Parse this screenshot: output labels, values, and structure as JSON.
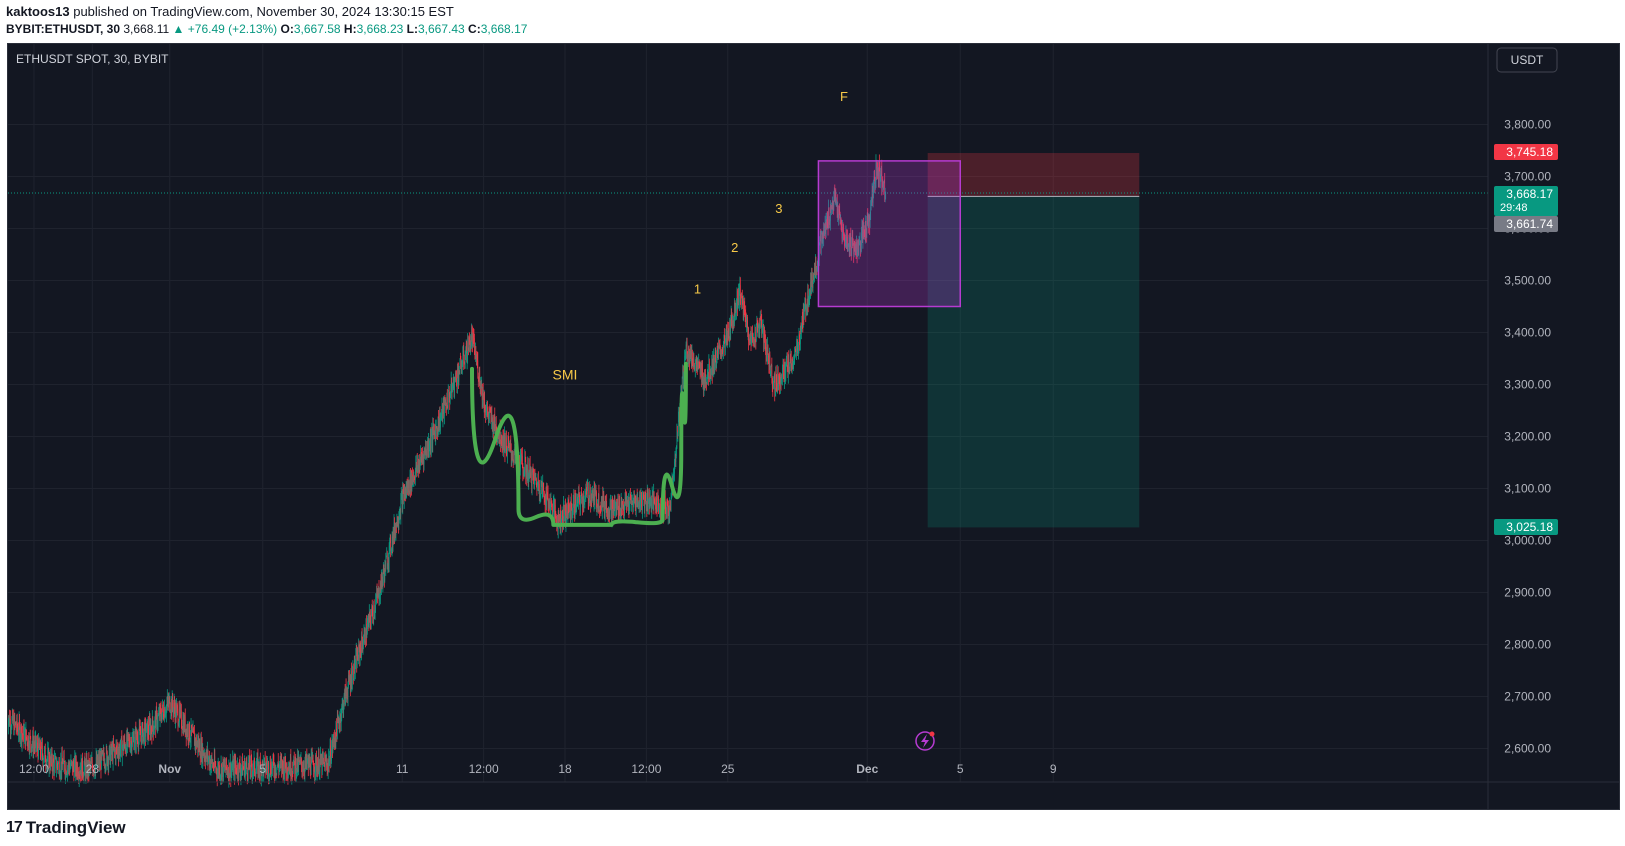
{
  "header": {
    "user": "kaktoos13",
    "published": "published on TradingView.com, November 30, 2024 13:30:15 EST",
    "symbol": "BYBIT:ETHUSDT, 30",
    "last": "3,668.11",
    "change": "▲ +76.49 (+2.13%)",
    "o_label": "O:",
    "o_value": "3,667.58",
    "h_label": "H:",
    "h_value": "3,668.23",
    "l_label": "L:",
    "l_value": "3,667.43",
    "c_label": "C:",
    "c_value": "3,668.17"
  },
  "pane": {
    "legend": "ETHUSDT SPOT, 30, BYBIT",
    "currency": "USDT"
  },
  "price_labels": {
    "stop": "3,745.18",
    "current": "3,668.17",
    "countdown": "29:48",
    "entry": "3,661.74",
    "target": "3,025.18"
  },
  "annotations": {
    "smi": "SMI",
    "w1": "1",
    "w2": "2",
    "w3": "3",
    "f": "F"
  },
  "footer": {
    "brand": "TradingView",
    "logo": "17"
  },
  "colors": {
    "background": "#131722",
    "grid": "#1f232e",
    "up": "#089981",
    "down": "#f23645",
    "curve": "#4caf50",
    "box": "#b63bd1",
    "annotation": "#f7c948"
  },
  "chart_data": {
    "type": "candlestick",
    "title": "ETHUSDT SPOT, 30, BYBIT",
    "ylim": [
      2580,
      3880
    ],
    "y_ticks": [
      2600,
      2700,
      2800,
      2900,
      3000,
      3100,
      3200,
      3300,
      3400,
      3500,
      3600,
      3700,
      3800
    ],
    "y_tick_labels": [
      "2,600.00",
      "2,700.00",
      "2,800.00",
      "2,900.00",
      "3,000.00",
      "3,100.00",
      "3,200.00",
      "3,300.00",
      "3,400.00",
      "3,500.00",
      "3,600.00",
      "3,700.00",
      "3,800.00"
    ],
    "x_range": [
      "2024-10-25",
      "2024-12-12"
    ],
    "x_ticks": [
      {
        "t": 1.16,
        "label": "12:00"
      },
      {
        "t": 3.67,
        "label": "28"
      },
      {
        "t": 7.0,
        "label": "Nov"
      },
      {
        "t": 11.0,
        "label": "5"
      },
      {
        "t": 17.0,
        "label": "11"
      },
      {
        "t": 20.5,
        "label": "12:00"
      },
      {
        "t": 24.0,
        "label": "18"
      },
      {
        "t": 27.5,
        "label": "12:00"
      },
      {
        "t": 31.0,
        "label": "25"
      },
      {
        "t": 37.0,
        "label": "Dec"
      },
      {
        "t": 41.0,
        "label": "5"
      },
      {
        "t": 45.0,
        "label": "9"
      }
    ],
    "price_path": [
      [
        0.0,
        2660
      ],
      [
        1.2,
        2605
      ],
      [
        2.0,
        2570
      ],
      [
        3.5,
        2560
      ],
      [
        6.2,
        2640
      ],
      [
        7.0,
        2690
      ],
      [
        8.0,
        2620
      ],
      [
        9.0,
        2560
      ],
      [
        13.8,
        2570
      ],
      [
        14.6,
        2710
      ],
      [
        16.0,
        2900
      ],
      [
        17.0,
        3080
      ],
      [
        18.5,
        3220
      ],
      [
        20.0,
        3390
      ],
      [
        20.6,
        3250
      ],
      [
        21.5,
        3180
      ],
      [
        23.0,
        3100
      ],
      [
        23.7,
        3040
      ],
      [
        25.0,
        3090
      ],
      [
        26.0,
        3060
      ],
      [
        27.5,
        3080
      ],
      [
        28.5,
        3060
      ],
      [
        29.2,
        3370
      ],
      [
        30.0,
        3310
      ],
      [
        31.0,
        3390
      ],
      [
        31.5,
        3480
      ],
      [
        32.0,
        3380
      ],
      [
        32.4,
        3420
      ],
      [
        33.0,
        3300
      ],
      [
        33.9,
        3350
      ],
      [
        34.3,
        3440
      ],
      [
        35.0,
        3570
      ],
      [
        35.6,
        3660
      ],
      [
        36.0,
        3580
      ],
      [
        36.6,
        3560
      ],
      [
        37.1,
        3620
      ],
      [
        37.4,
        3720
      ],
      [
        37.8,
        3680
      ]
    ],
    "smi_curve": [
      [
        20.0,
        3330
      ],
      [
        22.0,
        3060
      ],
      [
        23.5,
        3030
      ],
      [
        26.0,
        3030
      ],
      [
        28.2,
        3040
      ],
      [
        29.0,
        3170
      ],
      [
        29.2,
        3340
      ]
    ],
    "rectangle": {
      "t_from": 34.9,
      "t_to": 41.0,
      "price_from": 3450,
      "price_to": 3730
    },
    "position": {
      "type": "short",
      "t_from": 39.6,
      "t_to": 48.7,
      "stop": 3745.18,
      "entry": 3661.74,
      "target": 3025.18
    },
    "current_price": 3668.17,
    "labels_positions": [
      {
        "text_key": "smi",
        "t": 24.0,
        "price": 3310
      },
      {
        "text_key": "w1",
        "t": 29.7,
        "price": 3475
      },
      {
        "text_key": "w2",
        "t": 31.3,
        "price": 3555
      },
      {
        "text_key": "w3",
        "t": 33.2,
        "price": 3630
      },
      {
        "text_key": "f",
        "t": 36.0,
        "price": 3845
      }
    ]
  }
}
